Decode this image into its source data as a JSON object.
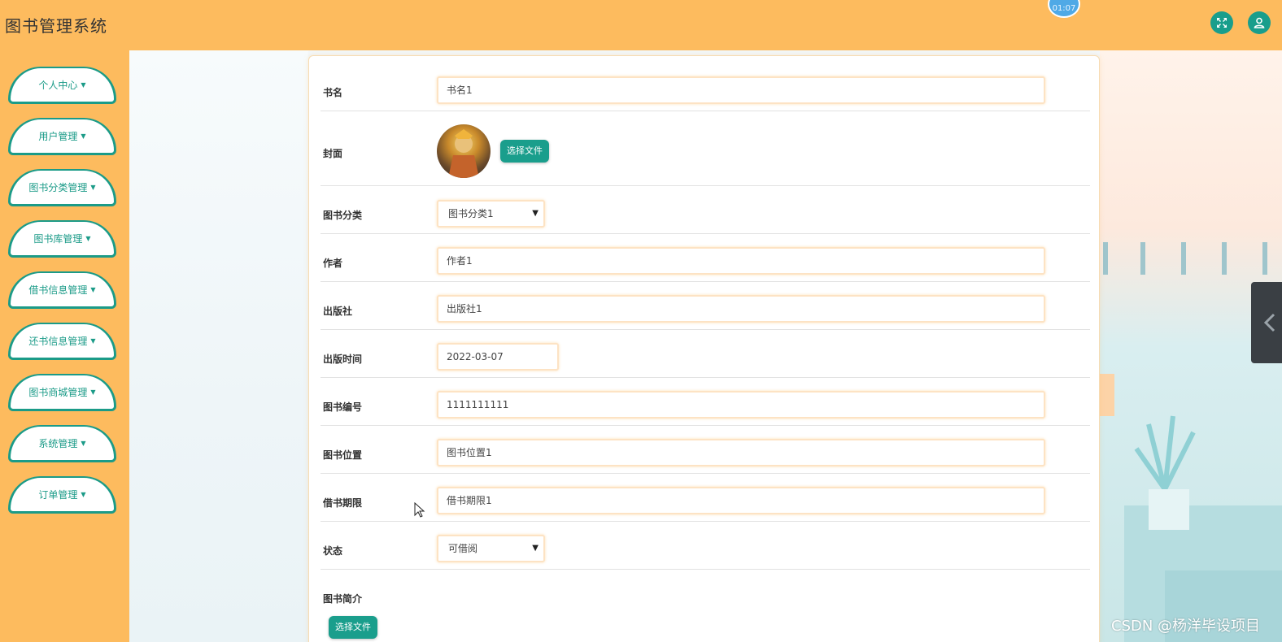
{
  "header": {
    "title": "图书管理系统",
    "timer": "01:07",
    "icons": [
      "fullscreen-icon",
      "user-icon"
    ],
    "accent": "#fdbb5e",
    "button_color": "#199e8c"
  },
  "sidebar": {
    "items": [
      {
        "label": "个人中心"
      },
      {
        "label": "用户管理"
      },
      {
        "label": "图书分类管理"
      },
      {
        "label": "图书库管理"
      },
      {
        "label": "借书信息管理"
      },
      {
        "label": "还书信息管理"
      },
      {
        "label": "图书商城管理"
      },
      {
        "label": "系统管理"
      },
      {
        "label": "订单管理"
      }
    ]
  },
  "form": {
    "book_name": {
      "label": "书名",
      "value": "书名1"
    },
    "cover": {
      "label": "封面",
      "button": "选择文件"
    },
    "category": {
      "label": "图书分类",
      "value": "图书分类1"
    },
    "author": {
      "label": "作者",
      "value": "作者1"
    },
    "publisher": {
      "label": "出版社",
      "value": "出版社1"
    },
    "publish_date": {
      "label": "出版时间",
      "value": "2022-03-07"
    },
    "book_number": {
      "label": "图书编号",
      "value": "1111111111"
    },
    "location": {
      "label": "图书位置",
      "value": "图书位置1"
    },
    "borrow_period": {
      "label": "借书期限",
      "value": "借书期限1"
    },
    "status": {
      "label": "状态",
      "value": "可借阅"
    },
    "intro": {
      "label": "图书简介",
      "button": "选择文件"
    }
  },
  "watermark": "CSDN @杨洋毕设项目"
}
